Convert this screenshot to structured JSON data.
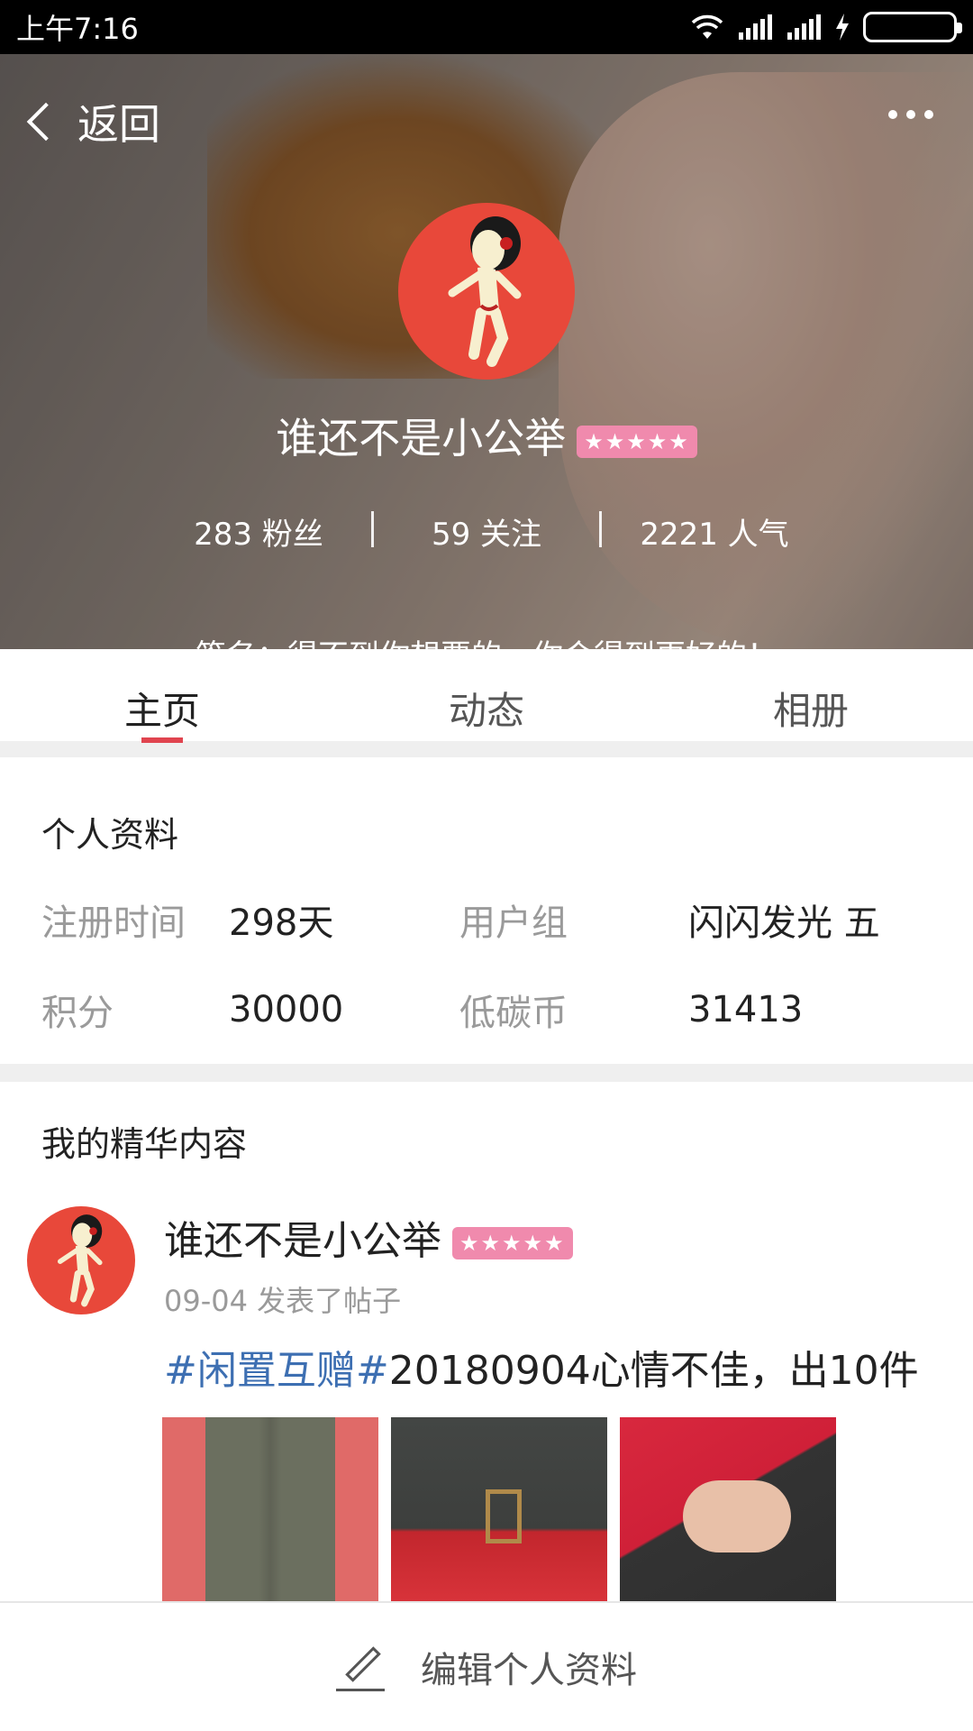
{
  "status_bar": {
    "time": "上午7:16"
  },
  "header": {
    "back_label": "返回",
    "username": "谁还不是小公举",
    "badge": "★★★★★",
    "stats": [
      {
        "label": "283 粉丝"
      },
      {
        "label": "59 关注"
      },
      {
        "label": "2221 人气"
      }
    ],
    "signature": "签名：得不到你想要的，你会得到更好的！"
  },
  "tabs": [
    "主页",
    "动态",
    "相册"
  ],
  "profile": {
    "title": "个人资料",
    "rows": [
      {
        "k1": "注册时间",
        "v1": "298天",
        "k2": "用户组",
        "v2": "闪闪发光 五"
      },
      {
        "k1": "积分",
        "v1": "30000",
        "k2": "低碳币",
        "v2": "31413"
      }
    ]
  },
  "featured": {
    "title": "我的精华内容",
    "post": {
      "username": "谁还不是小公举",
      "badge": "★★★★★",
      "meta": "09-04  发表了帖子",
      "tag": "#闲置互赠#",
      "text": "20180904心情不佳，出10件"
    }
  },
  "bottom": {
    "edit_label": "编辑个人资料"
  }
}
